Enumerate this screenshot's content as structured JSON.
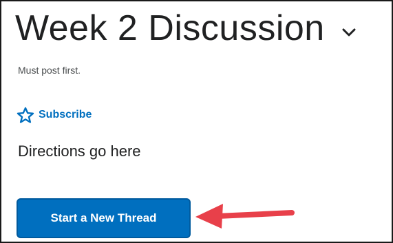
{
  "header": {
    "title": "Week 2 Discussion",
    "menu_icon": "chevron-down-icon"
  },
  "topic": {
    "restriction_note": "Must post first.",
    "subscribe_label": "Subscribe",
    "subscribe_icon": "star-outline-icon",
    "description": "Directions go here",
    "start_thread_label": "Start a New Thread"
  },
  "annotation": {
    "icon": "red-arrow-icon"
  },
  "colors": {
    "accent": "#006fbf",
    "button_border": "#005a9e",
    "title_text": "#202122",
    "annotation_arrow": "#e8404a"
  }
}
